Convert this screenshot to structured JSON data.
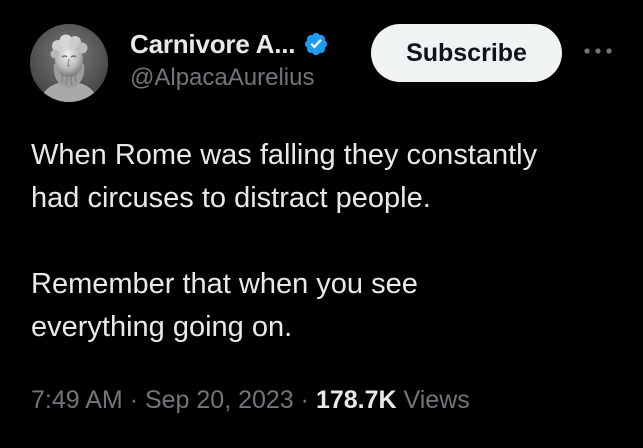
{
  "author": {
    "display_name": "Carnivore A...",
    "handle": "@AlpacaAurelius",
    "verified": true,
    "avatar_icon": "marble-bust-avatar"
  },
  "actions": {
    "subscribe_label": "Subscribe",
    "more_icon": "more-horizontal-icon"
  },
  "tweet": {
    "paragraphs": [
      [
        "When Rome was falling they constantly",
        "had circuses to distract people."
      ],
      [
        "Remember that when you see",
        "everything going on."
      ]
    ]
  },
  "meta": {
    "time": "7:49 AM",
    "separator": "·",
    "date": "Sep 20, 2023",
    "views_count": "178.7K",
    "views_label": "Views"
  },
  "colors": {
    "background": "#000000",
    "text_primary": "#e7e9ea",
    "text_secondary": "#71767b",
    "verified_blue": "#1d9bf0",
    "button_bg": "#eff3f4"
  }
}
